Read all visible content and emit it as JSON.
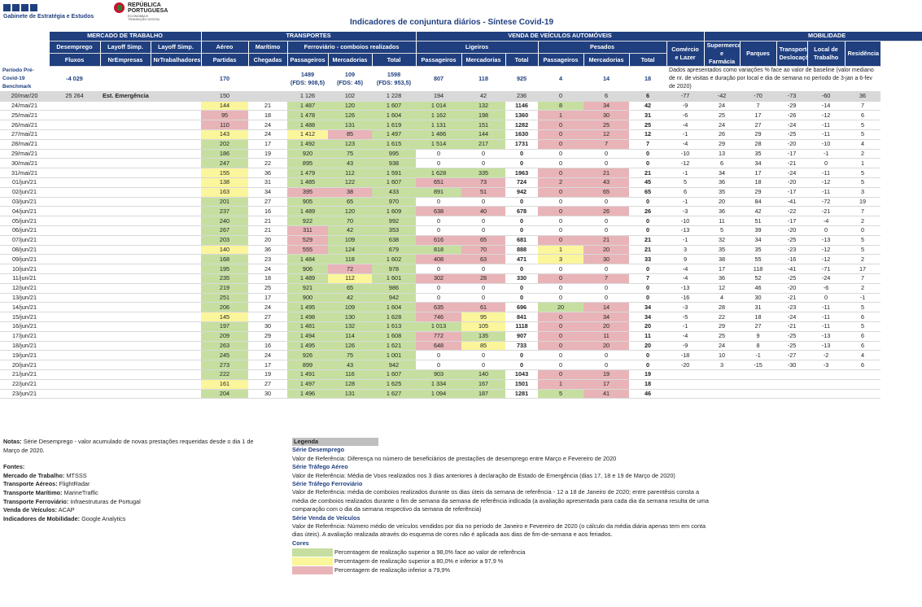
{
  "header": {
    "org": "Gabinete de Estratégia e Estudos",
    "gov_line1": "REPÚBLICA",
    "gov_line2": "PORTUGUESA",
    "gov_sub1": "ECONOMIA E",
    "gov_sub2": "TRANSIÇÃO DIGITAL",
    "title": "Indicadores de conjuntura diários - Síntese Covid-19"
  },
  "columns": {
    "groups": [
      "MERCADO DE TRABALHO",
      "TRANSPORTES",
      "VENDA DE VEÍCULOS AUTOMÓVEIS",
      "MOBILIDADE"
    ],
    "row2": [
      "Desemprego",
      "Layoff Simp.",
      "Layoff Simp.",
      "Aéreo",
      "Marítimo",
      "Ferroviário - comboios realizados",
      "Ligeiros",
      "Pesados",
      "Comércio e Lazer",
      "Supermercados e Farmácia",
      "Parques",
      "Transportes/ Deslocações",
      "Local de Trabalho",
      "Residência"
    ],
    "row3": [
      "Fluxos",
      "NrEmpresas",
      "NrTrabalhadores",
      "Partidas",
      "Chegadas",
      "Passageiros",
      "Mercadorias",
      "Total",
      "Passageiros",
      "Mercadorias",
      "Total",
      "Passageiros",
      "Mercadorias",
      "Total"
    ]
  },
  "benchmark": {
    "label": "Período Pré-Covid-19 Benchmark",
    "fluxos": "-4 029",
    "partidas": "170",
    "ferro_pass": "1489",
    "ferro_pass_fds": "(FDS: 908,5)",
    "ferro_merc": "109",
    "ferro_merc_fds": "(FDS: 45)",
    "ferro_total": "1598",
    "ferro_total_fds": "(FDS: 953,5)",
    "lig_pass": "807",
    "lig_merc": "118",
    "lig_total": "925",
    "pes_pass": "4",
    "pes_merc": "14",
    "pes_total": "18",
    "mob_note": "Dados apresentados como variações % face ao valor de baseline (valor mediano de nr. de visitas e duração por local e dia de semana no período de 3-jan a 6-fev de 2020)"
  },
  "emergency": {
    "date": "20/mar/20",
    "fluxos": "25 264",
    "label": "Est. Emergência",
    "values": [
      "150",
      "",
      "1 126",
      "102",
      "1 228",
      "194",
      "42",
      "236",
      "0",
      "6",
      "6",
      "-77",
      "-42",
      "-70",
      "-73",
      "-60",
      "36"
    ]
  },
  "rows": [
    [
      "24/mai/21",
      "144",
      "21",
      "1 487",
      "120",
      "1 607",
      "1 014",
      "132",
      "1146",
      "8",
      "34",
      "42",
      "-9",
      "24",
      "7",
      "-29",
      "-14",
      "7"
    ],
    [
      "25/mai/21",
      "95",
      "18",
      "1 478",
      "126",
      "1 604",
      "1 162",
      "198",
      "1360",
      "1",
      "30",
      "31",
      "-6",
      "25",
      "17",
      "-26",
      "-12",
      "6"
    ],
    [
      "26/mai/21",
      "110",
      "24",
      "1 488",
      "131",
      "1 619",
      "1 131",
      "151",
      "1282",
      "0",
      "25",
      "25",
      "-4",
      "24",
      "27",
      "-24",
      "-11",
      "5"
    ],
    [
      "27/mai/21",
      "143",
      "24",
      "1 412",
      "85",
      "1 497",
      "1 486",
      "144",
      "1630",
      "0",
      "12",
      "12",
      "-1",
      "26",
      "29",
      "-25",
      "-11",
      "5"
    ],
    [
      "28/mai/21",
      "202",
      "17",
      "1 492",
      "123",
      "1 615",
      "1 514",
      "217",
      "1731",
      "0",
      "7",
      "7",
      "-4",
      "29",
      "28",
      "-20",
      "-10",
      "4"
    ],
    [
      "29/mai/21",
      "186",
      "19",
      "920",
      "75",
      "995",
      "0",
      "0",
      "0",
      "0",
      "0",
      "0",
      "-10",
      "13",
      "35",
      "-17",
      "-1",
      "2"
    ],
    [
      "30/mai/21",
      "247",
      "22",
      "895",
      "43",
      "938",
      "0",
      "0",
      "0",
      "0",
      "0",
      "0",
      "-12",
      "6",
      "34",
      "-21",
      "0",
      "1"
    ],
    [
      "31/mai/21",
      "155",
      "36",
      "1 479",
      "112",
      "1 591",
      "1 628",
      "335",
      "1963",
      "0",
      "21",
      "21",
      "-1",
      "34",
      "17",
      "-24",
      "-11",
      "5"
    ],
    [
      "01/jun/21",
      "138",
      "31",
      "1 485",
      "122",
      "1 607",
      "651",
      "73",
      "724",
      "2",
      "43",
      "45",
      "5",
      "36",
      "18",
      "-20",
      "-12",
      "5"
    ],
    [
      "02/jun/21",
      "163",
      "34",
      "395",
      "38",
      "433",
      "891",
      "51",
      "942",
      "0",
      "65",
      "65",
      "6",
      "35",
      "29",
      "-17",
      "-11",
      "3"
    ],
    [
      "03/jun/21",
      "201",
      "27",
      "905",
      "65",
      "970",
      "0",
      "0",
      "0",
      "0",
      "0",
      "0",
      "-1",
      "20",
      "84",
      "-41",
      "-72",
      "19"
    ],
    [
      "04/jun/21",
      "237",
      "16",
      "1 489",
      "120",
      "1 609",
      "638",
      "40",
      "678",
      "0",
      "26",
      "26",
      "-3",
      "36",
      "42",
      "-22",
      "-21",
      "7"
    ],
    [
      "05/jun/21",
      "240",
      "21",
      "922",
      "70",
      "992",
      "0",
      "0",
      "0",
      "0",
      "0",
      "0",
      "-10",
      "11",
      "51",
      "-17",
      "-4",
      "2"
    ],
    [
      "06/jun/21",
      "267",
      "21",
      "311",
      "42",
      "353",
      "0",
      "0",
      "0",
      "0",
      "0",
      "0",
      "-13",
      "5",
      "39",
      "-20",
      "0",
      "0"
    ],
    [
      "07/jun/21",
      "203",
      "20",
      "529",
      "109",
      "638",
      "616",
      "65",
      "681",
      "0",
      "21",
      "21",
      "-1",
      "32",
      "34",
      "-25",
      "-13",
      "5"
    ],
    [
      "08/jun/21",
      "140",
      "36",
      "555",
      "124",
      "679",
      "818",
      "70",
      "888",
      "1",
      "20",
      "21",
      "3",
      "35",
      "35",
      "-23",
      "-12",
      "5"
    ],
    [
      "09/jun/21",
      "168",
      "23",
      "1 484",
      "118",
      "1 602",
      "408",
      "63",
      "471",
      "3",
      "30",
      "33",
      "9",
      "38",
      "55",
      "-16",
      "-12",
      "2"
    ],
    [
      "10/jun/21",
      "195",
      "24",
      "906",
      "72",
      "978",
      "0",
      "0",
      "0",
      "0",
      "0",
      "0",
      "-4",
      "17",
      "118",
      "-41",
      "-71",
      "17"
    ],
    [
      "11/jun/21",
      "235",
      "18",
      "1 489",
      "112",
      "1 601",
      "302",
      "28",
      "330",
      "0",
      "7",
      "7",
      "-4",
      "36",
      "52",
      "-25",
      "-24",
      "7"
    ],
    [
      "12/jun/21",
      "219",
      "25",
      "921",
      "65",
      "986",
      "0",
      "0",
      "0",
      "0",
      "0",
      "0",
      "-13",
      "12",
      "46",
      "-20",
      "-6",
      "2"
    ],
    [
      "13/jun/21",
      "251",
      "17",
      "900",
      "42",
      "942",
      "0",
      "0",
      "0",
      "0",
      "0",
      "0",
      "-16",
      "4",
      "30",
      "-21",
      "0",
      "-1"
    ],
    [
      "14/jun/21",
      "206",
      "24",
      "1 495",
      "109",
      "1 604",
      "635",
      "61",
      "696",
      "20",
      "14",
      "34",
      "-3",
      "28",
      "31",
      "-23",
      "-11",
      "5"
    ],
    [
      "15/jun/21",
      "145",
      "27",
      "1 498",
      "130",
      "1 628",
      "746",
      "95",
      "841",
      "0",
      "34",
      "34",
      "-5",
      "22",
      "18",
      "-24",
      "-11",
      "6"
    ],
    [
      "16/jun/21",
      "197",
      "30",
      "1 481",
      "132",
      "1 613",
      "1 013",
      "105",
      "1118",
      "0",
      "20",
      "20",
      "-1",
      "29",
      "27",
      "-21",
      "-11",
      "5"
    ],
    [
      "17/jun/21",
      "209",
      "29",
      "1 494",
      "114",
      "1 608",
      "772",
      "135",
      "907",
      "0",
      "11",
      "11",
      "-4",
      "25",
      "9",
      "-25",
      "-13",
      "6"
    ],
    [
      "18/jun/21",
      "263",
      "16",
      "1 495",
      "126",
      "1 621",
      "648",
      "85",
      "733",
      "0",
      "20",
      "20",
      "-9",
      "24",
      "8",
      "-25",
      "-13",
      "6"
    ],
    [
      "19/jun/21",
      "245",
      "24",
      "926",
      "75",
      "1 001",
      "0",
      "0",
      "0",
      "0",
      "0",
      "0",
      "-18",
      "10",
      "-1",
      "-27",
      "-2",
      "4"
    ],
    [
      "20/jun/21",
      "273",
      "17",
      "899",
      "43",
      "942",
      "0",
      "0",
      "0",
      "0",
      "0",
      "0",
      "-20",
      "3",
      "-15",
      "-30",
      "-3",
      "6"
    ],
    [
      "21/jun/21",
      "222",
      "19",
      "1 491",
      "116",
      "1 607",
      "903",
      "140",
      "1043",
      "0",
      "19",
      "19",
      "",
      "",
      "",
      "",
      "",
      ""
    ],
    [
      "22/jun/21",
      "161",
      "27",
      "1 497",
      "128",
      "1 625",
      "1 334",
      "167",
      "1501",
      "1",
      "17",
      "18",
      "",
      "",
      "",
      "",
      "",
      ""
    ],
    [
      "23/jun/21",
      "204",
      "30",
      "1 496",
      "131",
      "1 627",
      "1 094",
      "187",
      "1281",
      "5",
      "41",
      "46",
      "",
      "",
      "",
      "",
      "",
      ""
    ]
  ],
  "row_colors": [
    [
      "y",
      "",
      "g",
      "g",
      "g",
      "g",
      "g",
      "",
      "g",
      "r",
      ""
    ],
    [
      "r",
      "",
      "g",
      "g",
      "g",
      "g",
      "g",
      "",
      "r",
      "r",
      ""
    ],
    [
      "r",
      "",
      "g",
      "g",
      "g",
      "g",
      "g",
      "",
      "r",
      "r",
      ""
    ],
    [
      "y",
      "",
      "y",
      "r",
      "g",
      "g",
      "g",
      "",
      "r",
      "r",
      ""
    ],
    [
      "g",
      "",
      "g",
      "g",
      "g",
      "g",
      "g",
      "",
      "r",
      "r",
      ""
    ],
    [
      "g",
      "",
      "g",
      "g",
      "g",
      "e",
      "e",
      "",
      "e",
      "e",
      ""
    ],
    [
      "g",
      "",
      "g",
      "g",
      "g",
      "e",
      "e",
      "",
      "e",
      "e",
      ""
    ],
    [
      "y",
      "",
      "g",
      "g",
      "g",
      "g",
      "g",
      "",
      "r",
      "r",
      ""
    ],
    [
      "y",
      "",
      "g",
      "g",
      "g",
      "r",
      "r",
      "",
      "r",
      "r",
      ""
    ],
    [
      "y",
      "",
      "r",
      "r",
      "g",
      "g",
      "r",
      "",
      "r",
      "r",
      ""
    ],
    [
      "g",
      "",
      "g",
      "g",
      "g",
      "e",
      "e",
      "",
      "e",
      "e",
      ""
    ],
    [
      "g",
      "",
      "g",
      "g",
      "g",
      "r",
      "r",
      "",
      "r",
      "r",
      ""
    ],
    [
      "g",
      "",
      "g",
      "g",
      "g",
      "e",
      "e",
      "",
      "e",
      "e",
      ""
    ],
    [
      "g",
      "",
      "r",
      "g",
      "g",
      "e",
      "e",
      "",
      "e",
      "e",
      ""
    ],
    [
      "g",
      "",
      "r",
      "g",
      "g",
      "r",
      "r",
      "",
      "r",
      "r",
      ""
    ],
    [
      "y",
      "",
      "r",
      "g",
      "g",
      "g",
      "r",
      "",
      "y",
      "r",
      ""
    ],
    [
      "g",
      "",
      "g",
      "g",
      "g",
      "r",
      "r",
      "",
      "y",
      "r",
      ""
    ],
    [
      "g",
      "",
      "g",
      "r",
      "g",
      "e",
      "e",
      "",
      "e",
      "e",
      ""
    ],
    [
      "g",
      "",
      "g",
      "y",
      "g",
      "r",
      "r",
      "",
      "r",
      "r",
      ""
    ],
    [
      "g",
      "",
      "g",
      "g",
      "g",
      "e",
      "e",
      "",
      "e",
      "e",
      ""
    ],
    [
      "g",
      "",
      "g",
      "g",
      "g",
      "e",
      "e",
      "",
      "e",
      "e",
      ""
    ],
    [
      "g",
      "",
      "g",
      "g",
      "g",
      "r",
      "r",
      "",
      "g",
      "r",
      ""
    ],
    [
      "y",
      "",
      "g",
      "g",
      "g",
      "r",
      "y",
      "",
      "r",
      "r",
      ""
    ],
    [
      "g",
      "",
      "g",
      "g",
      "g",
      "g",
      "y",
      "",
      "r",
      "r",
      ""
    ],
    [
      "g",
      "",
      "g",
      "g",
      "g",
      "r",
      "g",
      "",
      "r",
      "r",
      ""
    ],
    [
      "g",
      "",
      "g",
      "g",
      "g",
      "r",
      "y",
      "",
      "r",
      "r",
      ""
    ],
    [
      "g",
      "",
      "g",
      "g",
      "g",
      "e",
      "e",
      "",
      "e",
      "e",
      ""
    ],
    [
      "g",
      "",
      "g",
      "g",
      "g",
      "e",
      "e",
      "",
      "e",
      "e",
      ""
    ],
    [
      "g",
      "",
      "g",
      "g",
      "g",
      "g",
      "g",
      "",
      "r",
      "r",
      ""
    ],
    [
      "y",
      "",
      "g",
      "g",
      "g",
      "g",
      "g",
      "",
      "r",
      "r",
      ""
    ],
    [
      "g",
      "",
      "g",
      "g",
      "g",
      "g",
      "g",
      "",
      "g",
      "r",
      ""
    ]
  ],
  "notes": {
    "label": "Notas:",
    "text": "Série Desemprego - valor acumulado de novas prestações requeridas desde o dia 1 de Março de 2020.",
    "sources_label": "Fontes:",
    "sources": [
      {
        "k": "Mercado de Trabalho:",
        "v": "MTSSS"
      },
      {
        "k": "Transporte Aéreos:",
        "v": "FlightRadar"
      },
      {
        "k": "Transporte Marítimo:",
        "v": "MarineTraffic"
      },
      {
        "k": "Transporte Ferroviário:",
        "v": "Infraestruturas de Portugal"
      },
      {
        "k": "Venda de Veículos:",
        "v": "ACAP"
      },
      {
        "k": "Indicadores de Mobilidade:",
        "v": "Google Analytics"
      }
    ]
  },
  "legend": {
    "title": "Legenda",
    "s1_title": "Série Desemprego",
    "s1_text": "Valor de Referência: Diferença no número de beneficiários de prestações de desemprego entre Março e Fevereiro de 2020",
    "s2_title": "Série Tráfego Aéreo",
    "s2_text": "Valor de Referência: Média de Voos realizados nos 3 dias anteriores à declaração de Estado de Emergência (dias 17, 18 e 19 de Março de 2020)",
    "s3_title": "Série Tráfego Ferroviário",
    "s3_text": "Valor de Referência: média de comboios realizados durante os dias úteis da semana de referência - 12 a 18 de Janeiro de 2020; entre parentêsis consta a média de comboios realizados durante o fim de semana da semana de referência indicada (a avaliação apresentada para cada dia da semana resulta de uma comparação com o dia da semana respectivo da semana de referência)",
    "s4_title": "Série Venda de Veículos",
    "s4_text": "Valor de Referência: Número médio de veículos vendidos por dia no período de Janeiro e Fevereiro de 2020 (o cálculo da média diária apenas tem em conta dias úteis). A avaliação realizada através do esquema de cores não é aplicada aos dias de fim-de-semana e aos feriados.",
    "colors_title": "Cores",
    "c1": "Percentagem de realização superior a 98,0% face ao valor de referência",
    "c2": "Percentagem de realização superior a 80,0% e inferior a 97,9 %",
    "c3": "Percentagem de realização inferior a 79,9%"
  },
  "colors": {
    "navy": "#1f3f7f",
    "green": "#c6dfa0",
    "yellow": "#fbf59b",
    "red": "#e8b4b8",
    "grey": "#d9d9d9"
  }
}
